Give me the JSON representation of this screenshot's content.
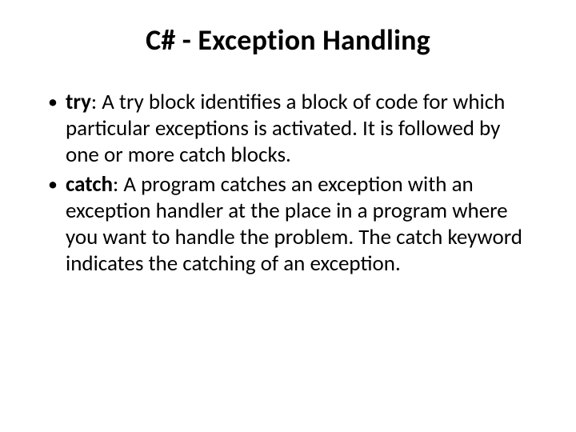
{
  "title": "C# - Exception Handling",
  "bullets": [
    {
      "keyword": "try",
      "rest": ": A try block identifies a block of code for which particular exceptions is activated. It is followed by one or more catch blocks."
    },
    {
      "keyword": "catch",
      "rest": ": A program catches an exception with an exception handler at the place in a program where you want to handle the problem. The catch keyword indicates the catching of an exception."
    }
  ]
}
